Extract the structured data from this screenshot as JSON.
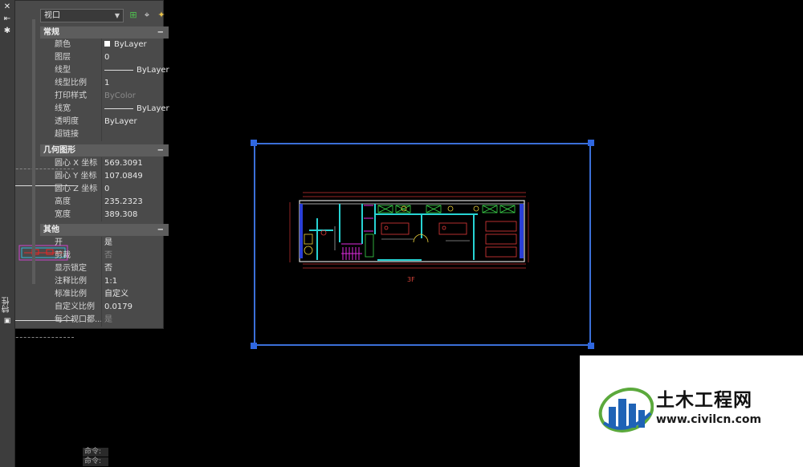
{
  "palette": {
    "title": "特性",
    "object_type": "视口",
    "sections": [
      {
        "name": "常规",
        "rows": [
          {
            "k": "颜色",
            "v": "ByLayer",
            "kind": "color"
          },
          {
            "k": "图层",
            "v": "0"
          },
          {
            "k": "线型",
            "v": "ByLayer",
            "kind": "line"
          },
          {
            "k": "线型比例",
            "v": "1"
          },
          {
            "k": "打印样式",
            "v": "ByColor",
            "dim": true
          },
          {
            "k": "线宽",
            "v": "ByLayer",
            "kind": "line"
          },
          {
            "k": "透明度",
            "v": "ByLayer"
          },
          {
            "k": "超链接",
            "v": ""
          }
        ]
      },
      {
        "name": "几何图形",
        "rows": [
          {
            "k": "圆心 X 坐标",
            "v": "569.3091"
          },
          {
            "k": "圆心 Y 坐标",
            "v": "107.0849"
          },
          {
            "k": "圆心 Z 坐标",
            "v": "0"
          },
          {
            "k": "高度",
            "v": "235.2323"
          },
          {
            "k": "宽度",
            "v": "389.308"
          }
        ]
      },
      {
        "name": "其他",
        "rows": [
          {
            "k": "开",
            "v": "是"
          },
          {
            "k": "剪裁",
            "v": "否",
            "dim": true
          },
          {
            "k": "显示锁定",
            "v": "否"
          },
          {
            "k": "注释比例",
            "v": "1:1"
          },
          {
            "k": "标准比例",
            "v": "自定义"
          },
          {
            "k": "自定义比例",
            "v": "0.0179"
          },
          {
            "k": "每个视口都...",
            "v": "是",
            "dim": true
          }
        ]
      }
    ],
    "collapse_symbol": "−"
  },
  "command_line": [
    "命令:",
    "命令:"
  ],
  "drawing": {
    "floor_label": "3F"
  },
  "watermark": {
    "name": "土木工程网",
    "url": "www.civilcn.com"
  },
  "colors": {
    "viewport_border": "#3b6fd8",
    "palette_bg": "#4a4a4a",
    "canvas_bg": "#000000"
  }
}
